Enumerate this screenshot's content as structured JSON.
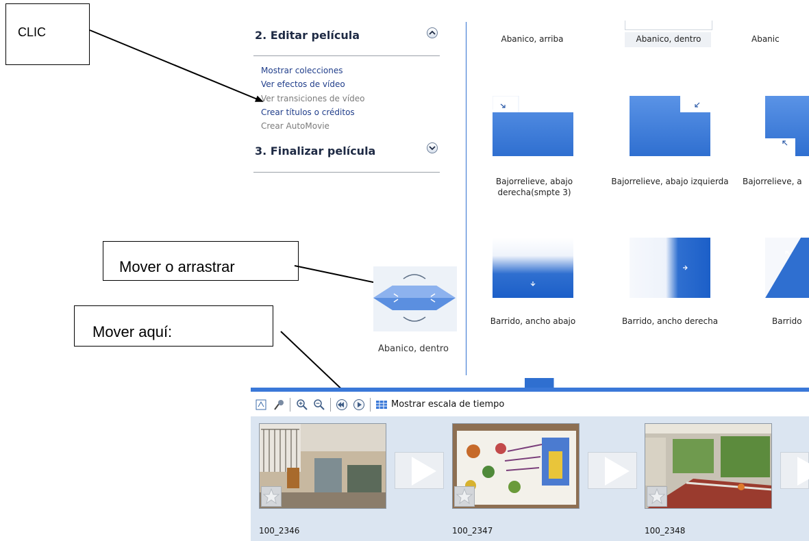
{
  "callouts": {
    "clic": "CLIC",
    "mover_arrastrar": "Mover o arrastrar",
    "mover_aqui": "Mover aquí:"
  },
  "tasks": {
    "edit_heading": "2. Editar película",
    "links": [
      {
        "label": "Mostrar colecciones",
        "enabled": true
      },
      {
        "label": "Ver efectos de vídeo",
        "enabled": true
      },
      {
        "label": "Ver transiciones de vídeo",
        "enabled": false
      },
      {
        "label": "Crear títulos o créditos",
        "enabled": true
      },
      {
        "label": "Crear AutoMovie",
        "enabled": false
      }
    ],
    "finish_heading": "3. Finalizar película"
  },
  "drag_preview": {
    "label": "Abanico, dentro"
  },
  "transitions": {
    "row1": [
      "Abanico, arriba",
      "Abanico, dentro",
      "Abanic"
    ],
    "row2": [
      "Bajorrelieve, abajo derecha(smpte 3)",
      "Bajorrelieve, abajo izquierda",
      "Bajorrelieve, a"
    ],
    "row3": [
      "Barrido, ancho abajo",
      "Barrido, ancho derecha",
      "Barrido"
    ]
  },
  "storyboard": {
    "show_timeline_label": "Mostrar escala de tiempo",
    "clips": [
      "100_2346",
      "100_2347",
      "100_2348"
    ]
  },
  "colors": {
    "accent_blue": "#3a78d8",
    "storyboard_bg": "#dbe5f1",
    "divider_blue": "#2f6fd0"
  }
}
